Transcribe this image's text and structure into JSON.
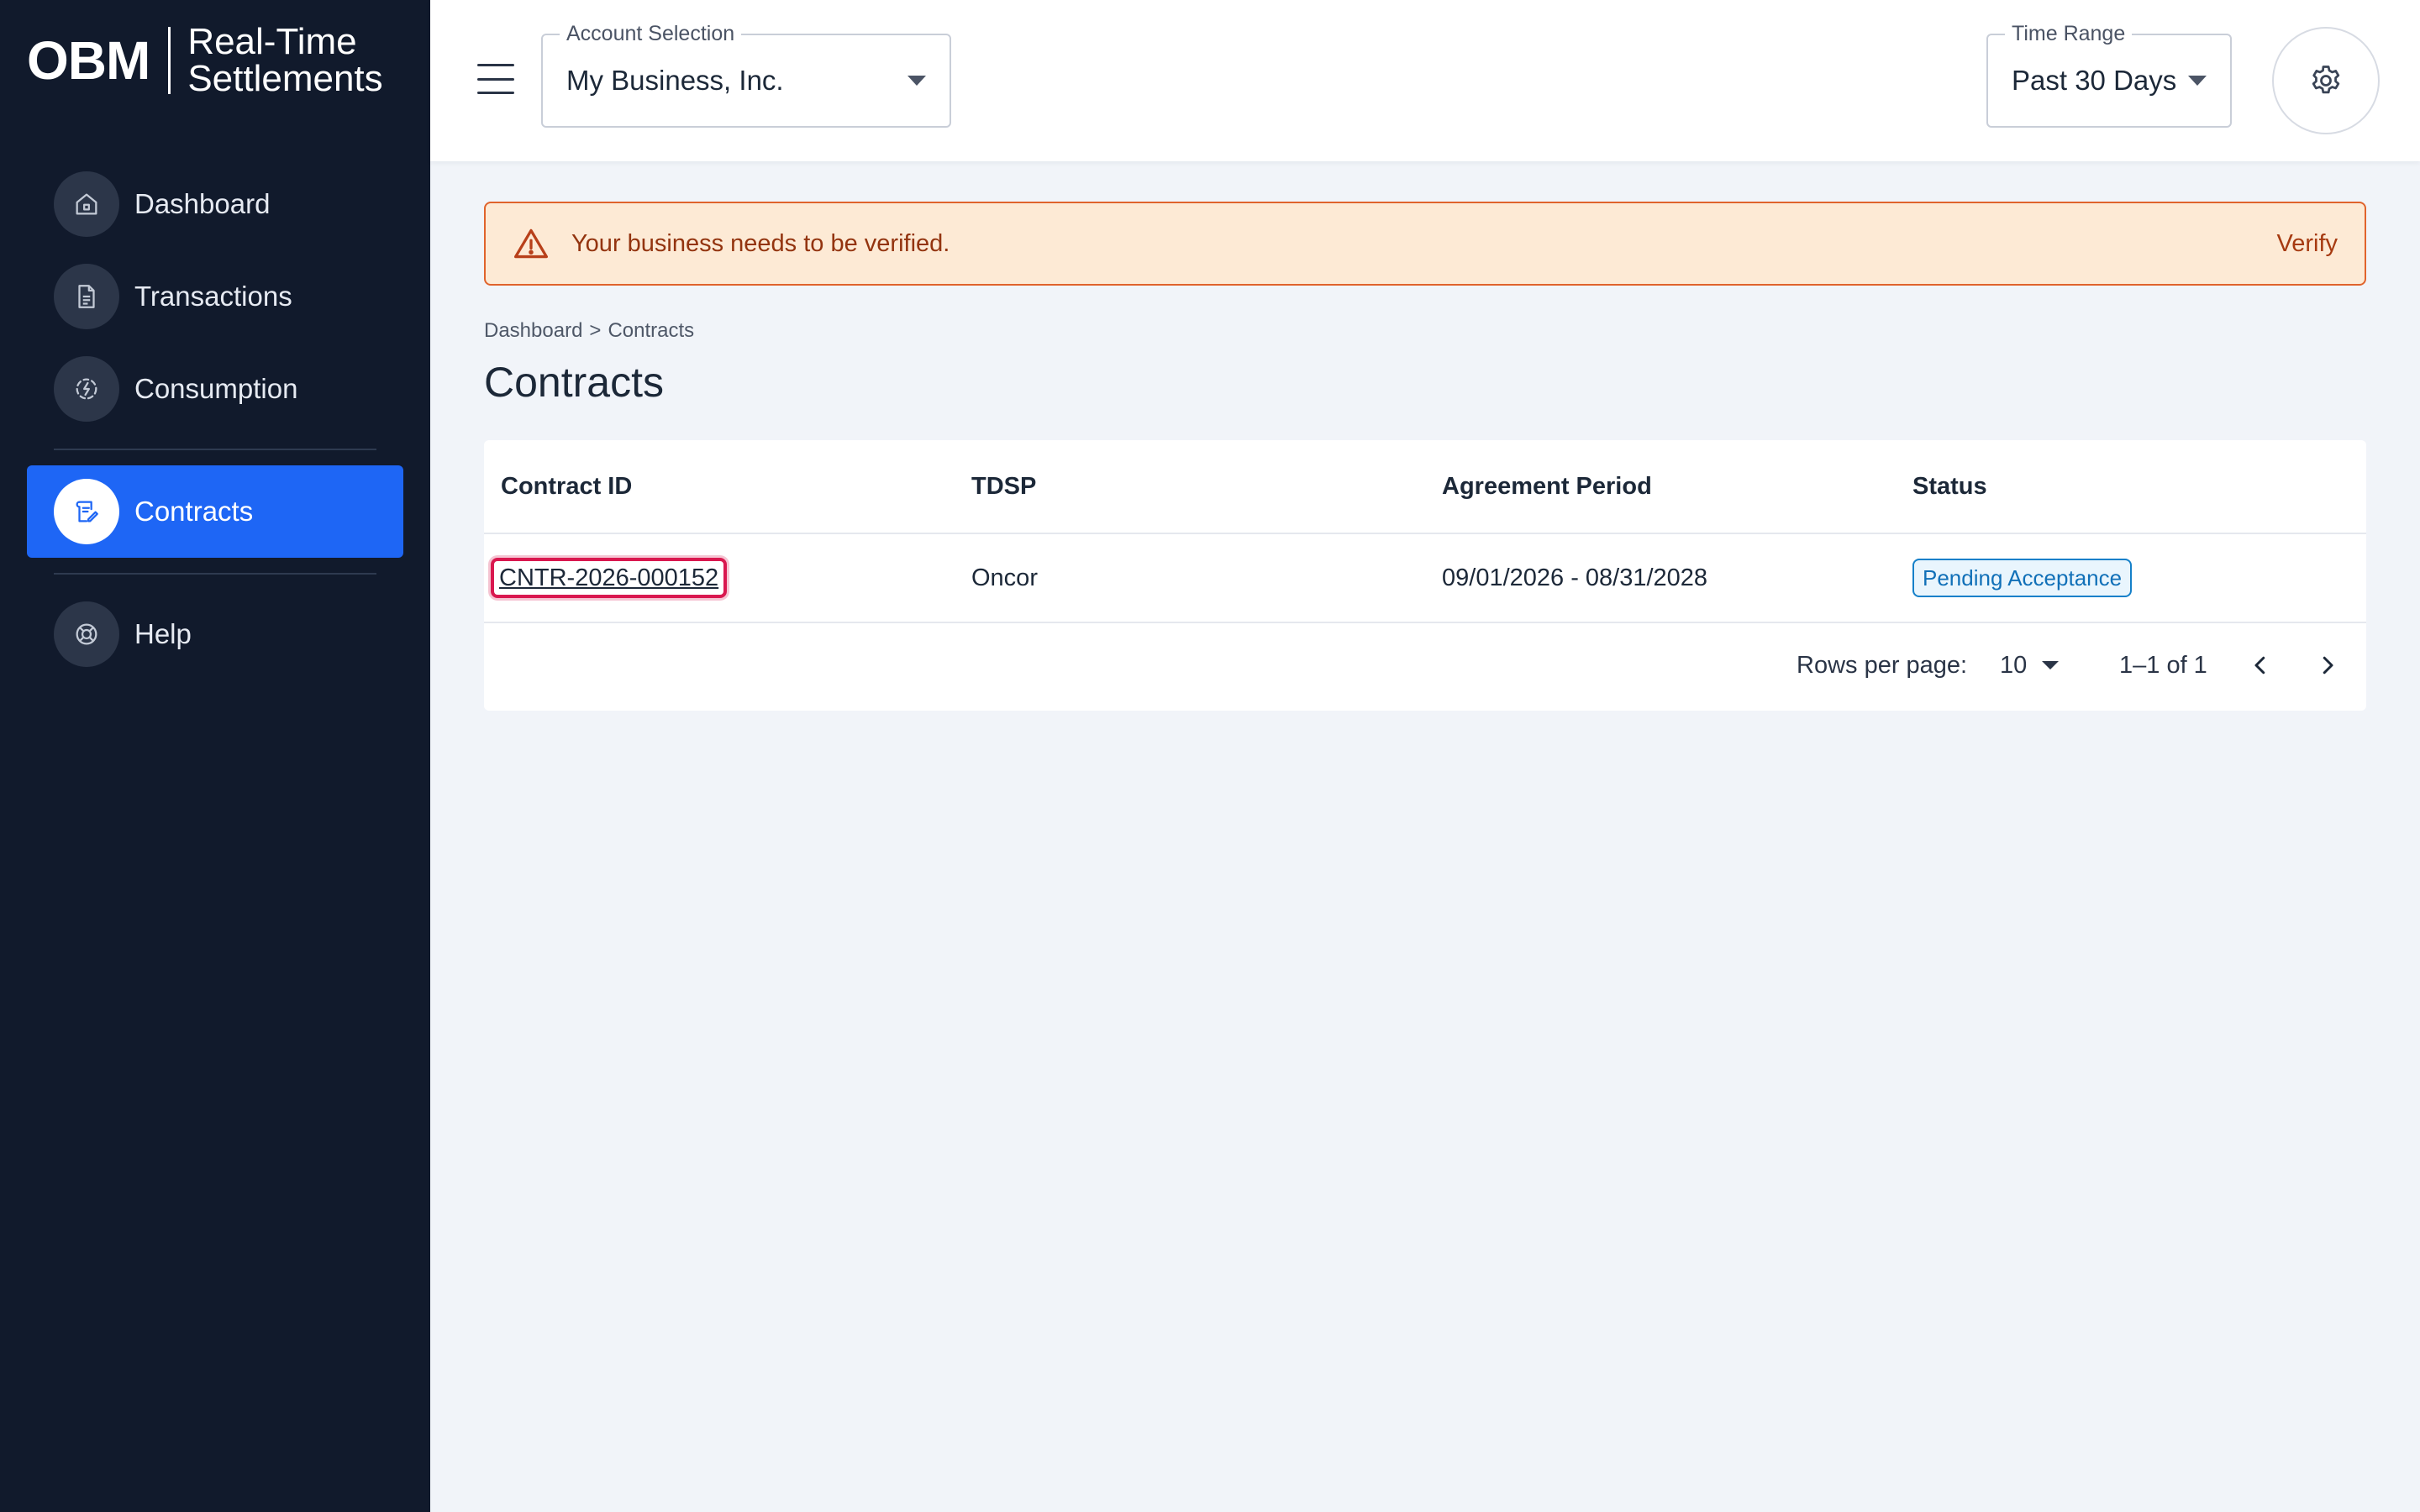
{
  "brand": {
    "logo_mark": "OBM",
    "product_line1": "Real-Time",
    "product_line2": "Settlements"
  },
  "sidebar": {
    "items": [
      {
        "label": "Dashboard",
        "icon": "home-icon",
        "active": false
      },
      {
        "label": "Transactions",
        "icon": "document-icon",
        "active": false
      },
      {
        "label": "Consumption",
        "icon": "lightning-cycle-icon",
        "active": false
      },
      {
        "label": "Contracts",
        "icon": "contract-edit-icon",
        "active": true
      },
      {
        "label": "Help",
        "icon": "lifebuoy-icon",
        "active": false
      }
    ]
  },
  "topbar": {
    "account_label": "Account Selection",
    "account_value": "My Business, Inc.",
    "time_label": "Time Range",
    "time_value": "Past 30 Days"
  },
  "alert": {
    "message": "Your business needs to be verified.",
    "action": "Verify"
  },
  "breadcrumb": {
    "root": "Dashboard",
    "separator": ">",
    "current": "Contracts"
  },
  "page": {
    "title": "Contracts"
  },
  "table": {
    "columns": [
      "Contract ID",
      "TDSP",
      "Agreement Period",
      "Status"
    ],
    "rows": [
      {
        "contract_id": "CNTR-2026-000152",
        "tdsp": "Oncor",
        "period": "09/01/2026 - 08/31/2028",
        "status": "Pending Acceptance"
      }
    ]
  },
  "pagination": {
    "rows_per_page_label": "Rows per page:",
    "rows_per_page": "10",
    "range": "1–1 of 1"
  },
  "colors": {
    "sidebar_bg": "#111a2c",
    "accent": "#1e66f5",
    "alert_bg": "#fdead5",
    "alert_border": "#e0632c",
    "status_blue": "#1580c9",
    "highlight_red": "#d9184f"
  }
}
